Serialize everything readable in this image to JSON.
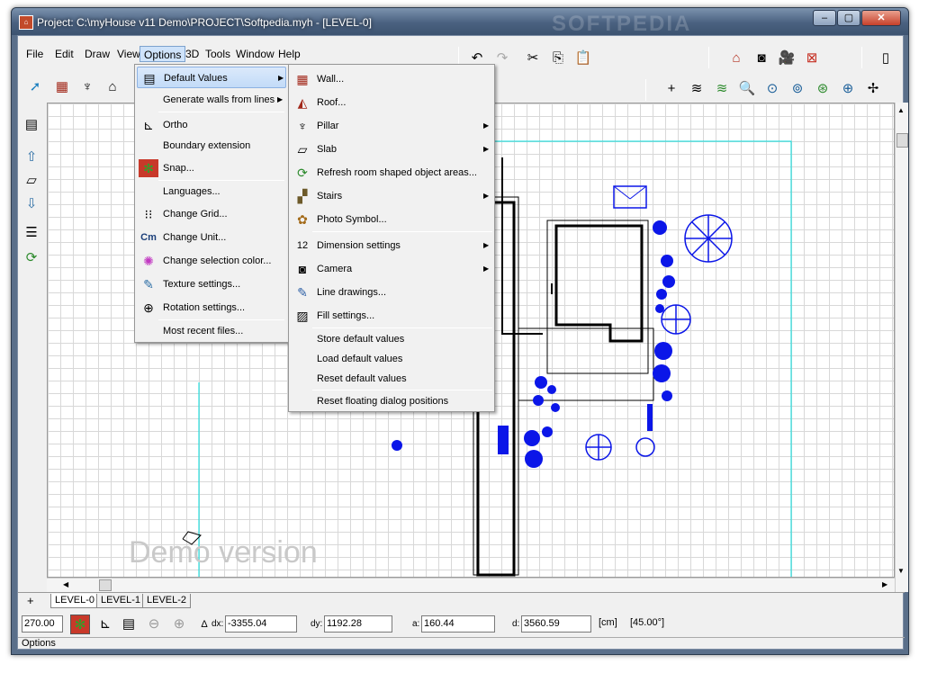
{
  "window": {
    "title": "Project: C:\\myHouse v11 Demo\\PROJECT\\Softpedia.myh - [LEVEL-0]",
    "watermark": "SOFTPEDIA",
    "min": "–",
    "max": "▢",
    "close": "✕"
  },
  "menubar": [
    "File",
    "Edit",
    "Draw",
    "View",
    "Options",
    "3D",
    "Tools",
    "Window",
    "Help"
  ],
  "options_menu": [
    {
      "label": "Default Values",
      "icon": "default-values-icon",
      "submenu": true
    },
    {
      "label": "Generate walls from lines",
      "icon": "",
      "submenu": true
    },
    {
      "label": "Ortho",
      "icon": "ortho-icon"
    },
    {
      "label": "Boundary extension",
      "icon": ""
    },
    {
      "label": "Snap...",
      "icon": "snap-icon"
    },
    {
      "label": "Languages...",
      "icon": ""
    },
    {
      "label": "Change Grid...",
      "icon": "grid-icon"
    },
    {
      "label": "Change Unit...",
      "icon": "unit-icon",
      "glyph": "Cm"
    },
    {
      "label": "Change selection color...",
      "icon": "color-wheel-icon"
    },
    {
      "label": "Texture settings...",
      "icon": "texture-icon"
    },
    {
      "label": "Rotation settings...",
      "icon": "rotation-icon"
    },
    {
      "label": "Most recent files...",
      "icon": ""
    }
  ],
  "default_values_menu": [
    {
      "label": "Wall...",
      "icon": "wall-icon"
    },
    {
      "label": "Roof...",
      "icon": "roof-icon"
    },
    {
      "label": "Pillar",
      "icon": "pillar-icon",
      "submenu": true
    },
    {
      "label": "Slab",
      "icon": "slab-icon",
      "submenu": true
    },
    {
      "label": "Refresh room shaped object areas...",
      "icon": "refresh-icon"
    },
    {
      "label": "Stairs",
      "icon": "stairs-icon",
      "submenu": true
    },
    {
      "label": "Photo Symbol...",
      "icon": "photo-symbol-icon"
    },
    {
      "label": "Dimension settings",
      "icon": "dimension-icon",
      "submenu": true,
      "glyph": "12"
    },
    {
      "label": "Camera",
      "icon": "camera-icon",
      "submenu": true
    },
    {
      "label": "Line drawings...",
      "icon": "line-drawing-icon"
    },
    {
      "label": "Fill settings...",
      "icon": "fill-icon"
    },
    {
      "label": "Store default values",
      "icon": ""
    },
    {
      "label": "Load default values",
      "icon": ""
    },
    {
      "label": "Reset default values",
      "icon": ""
    },
    {
      "label": "Reset floating dialog positions",
      "icon": ""
    }
  ],
  "canvas": {
    "demo_text": "Demo version"
  },
  "level_tabs": [
    "LEVEL-0",
    "LEVEL-1",
    "LEVEL-2"
  ],
  "tabs_plus": "+",
  "coords": {
    "angle": "270.00",
    "dx_label": "dx:",
    "dx": "-3355.04",
    "dy_label": "dy:",
    "dy": "1192.28",
    "a_label": "a:",
    "a": "160.44",
    "d_label": "d:",
    "d": "3560.59",
    "unit": "[cm]",
    "angle_deg": "[45.00°]"
  },
  "status": "Options",
  "colors": {
    "accent": "#c2dbf8",
    "blue_symbols": "#0b16e8",
    "highlight_border": "#8db2e3"
  }
}
